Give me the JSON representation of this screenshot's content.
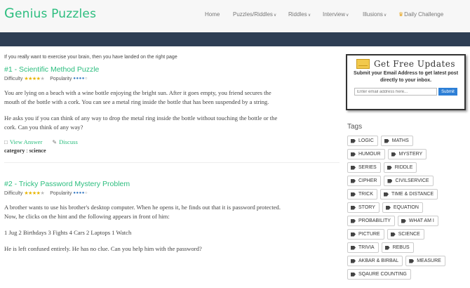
{
  "header": {
    "logo_first": "G",
    "logo_rest": "enius Puzzles",
    "nav": [
      {
        "label": "Home",
        "caret": false
      },
      {
        "label": "Puzzles/Riddles",
        "caret": true
      },
      {
        "label": "Riddles",
        "caret": true
      },
      {
        "label": "Interview",
        "caret": true
      },
      {
        "label": "Illusions",
        "caret": true
      },
      {
        "label": "Daily Challenge",
        "caret": false,
        "icon": "trophy-icon"
      }
    ]
  },
  "main": {
    "intro": "If you really want to exercise your brain, then you have landed on the right page",
    "difficulty_label": "Difficulty",
    "popularity_label": "Popularity",
    "view_answer_label": "View Answer",
    "discuss_label": "Discuss",
    "category_label": "category",
    "puzzles": [
      {
        "title": "#1 - Scientific Method Puzzle",
        "difficulty": 4,
        "popularity": 4,
        "paragraphs": [
          "You are lying on a beach with a wine bottle enjoying the bright sun. After it goes empty, you friend secures the mouth of the bottle with a cork. You can see a metal ring inside the bottle that has been suspended by a string.",
          "He asks you if you can think of any way to drop the metal ring inside the bottle without touching the bottle or the cork. Can you think of any way?"
        ],
        "category": "science"
      },
      {
        "title": "#2 - Tricky Password Mystery Problem",
        "difficulty": 4,
        "popularity": 4,
        "paragraphs": [
          "A brother wants to use his brother's desktop computer. When he opens it, he finds out that it is password protected. Now, he clicks on the hint and the following appears in front of him:",
          "1 Jug 2 Birthdays 3 Fights 4 Cars 2 Laptops 1 Watch",
          "He is left confused entirely. He has no clue. Can you help him with the password?"
        ]
      }
    ]
  },
  "sidebar": {
    "updates_title": "Get Free Updates",
    "updates_sub": "Submit your Email Address to get latest post directly to your inbox.",
    "email_placeholder": "Enter email address here...",
    "submit_label": "Submit",
    "tags_title": "Tags",
    "tag_rows": [
      [
        "LOGIC",
        "MATHS"
      ],
      [
        "HUMOUR",
        "MYSTERY"
      ],
      [
        "SERIES",
        "RIDDLE"
      ],
      [
        "CIPHER",
        "CIVILSERVICE"
      ],
      [
        "TRICK",
        "TIME & DISTANCE"
      ],
      [
        "STORY",
        "EQUATION"
      ],
      [
        "PROBABILITY",
        "WHAT AM I"
      ],
      [
        "PICTURE",
        "SCIENCE"
      ],
      [
        "TRIVIA",
        "REBUS"
      ],
      [
        "AKBAR & BIRBAL",
        "MEASURE"
      ],
      [
        "SQAURE COUNTING"
      ]
    ]
  },
  "colors": {
    "accent": "#2bbd7e",
    "band": "#2e3e54",
    "submit": "#2d7fd6"
  }
}
